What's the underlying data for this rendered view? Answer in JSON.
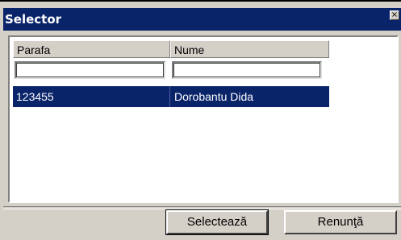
{
  "window": {
    "title": "Selector",
    "close_glyph": "×"
  },
  "grid": {
    "columns": [
      {
        "label": "Parafa",
        "filter_value": ""
      },
      {
        "label": "Nume",
        "filter_value": ""
      }
    ],
    "rows": [
      {
        "parafa": "123455",
        "nume": "Dorobantu Dida",
        "selected": true
      }
    ]
  },
  "buttons": {
    "select_label": "Selectează",
    "cancel_label": "Renunţă"
  },
  "colors": {
    "titlebar": "#0a246a",
    "selection": "#0a246a",
    "face": "#d4d0c8"
  }
}
